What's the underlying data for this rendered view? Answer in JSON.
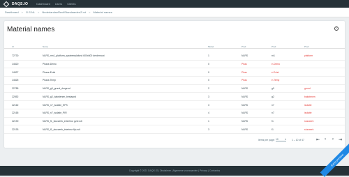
{
  "app": {
    "name": "DAQS.IO",
    "nav": [
      "Dashboard",
      "Users",
      "Clients"
    ]
  },
  "breadcrumb": [
    "Dashboard",
    "G.S.NL",
    "NederlandseRevitStandaardenZ.rvt",
    "Material names"
  ],
  "page": {
    "title": "Material names",
    "help_icon": "help-circle-icon"
  },
  "table": {
    "headers": [
      "Id",
      "Name",
      "Model",
      "Prod",
      "Prod",
      "Prod"
    ],
    "rows": [
      {
        "id": "72730",
        "name": "NLRS_mn1_platform_systeemplafond 600x600 derdenroot",
        "model": "1",
        "prod": "NLRS",
        "pn": "rn1",
        "pd": "platform",
        "pred": false,
        "pnred": false,
        "pdred": true
      },
      {
        "id": "14520",
        "name": "Phase-Demo",
        "model": "0",
        "prod": "Phas",
        "pn": "e-Demo",
        "pd": "",
        "pred": true,
        "pnred": true,
        "pdred": false
      },
      {
        "id": "14527",
        "name": "Phase-Exist",
        "model": "0",
        "prod": "Phas",
        "pn": "e-Exist",
        "pd": "",
        "pred": true,
        "pnred": true,
        "pdred": false
      },
      {
        "id": "14525",
        "name": "Phase-Temp",
        "model": "0",
        "prod": "Phas",
        "pn": "e-Temp",
        "pd": "",
        "pred": true,
        "pnred": true,
        "pdred": false
      },
      {
        "id": "22785",
        "name": "NLRS_g0_grond_drogend",
        "model": "2",
        "prod": "NLRS",
        "pn": "g0",
        "pd": "grond",
        "pred": false,
        "pnred": false,
        "pdred": true
      },
      {
        "id": "22552",
        "name": "NLRS_g2_bakstenen_bestaand",
        "model": "3",
        "prod": "NLRS",
        "pn": "g2",
        "pd": "bakstenen",
        "pred": false,
        "pnred": false,
        "pdred": true
      },
      {
        "id": "22162",
        "name": "NLRS_n7_isolatie_EPS",
        "model": "3",
        "prod": "NLRS",
        "pn": "n7",
        "pd": "isolatie",
        "pred": false,
        "pnred": false,
        "pdred": true
      },
      {
        "id": "22165",
        "name": "NLRS_n7_isolatie_PIR",
        "model": "4",
        "prod": "NLRS",
        "pn": "n7",
        "pd": "isolatie",
        "pred": false,
        "pnred": false,
        "pdred": true
      },
      {
        "id": "22190",
        "name": "NLRS_f1_stucwerk_exterieur gvcf-wit",
        "model": "1",
        "prod": "NLRS",
        "pn": "f1",
        "pd": "stucwerk",
        "pred": false,
        "pnred": false,
        "pdred": true
      },
      {
        "id": "22193",
        "name": "NLRS_f1_stucwerk_interieur fijn-wit",
        "model": "3",
        "prod": "NLRS",
        "pn": "f1",
        "pd": "stucwerk",
        "pred": false,
        "pnred": false,
        "pdred": true
      }
    ]
  },
  "pagination": {
    "label": "Items per page:",
    "per_page": "10",
    "range": "1 – 10 of 47"
  },
  "footer": {
    "text": "Copyright © 2021 DAQS.IO | Disclaimer | Algemene voorwaarden | Privacy | Contactus"
  },
  "ribbon": {
    "text": "Early preview"
  }
}
